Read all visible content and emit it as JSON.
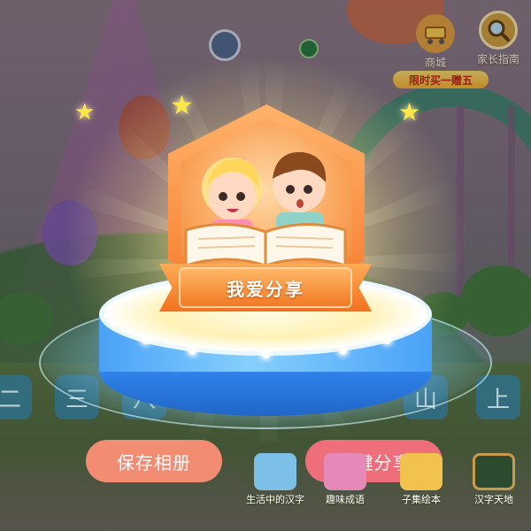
{
  "badge": {
    "title": "我爱分享",
    "artwork": "children-reading-book-illustration"
  },
  "actions": {
    "save_label": "保存相册",
    "share_label": "一键分享"
  },
  "top_bar": {
    "mall_label": "商城",
    "promo_label": "限时买一赠五",
    "parent_guide_label": "家长指南"
  },
  "char_tiles": [
    "二",
    "三",
    "八",
    "",
    "",
    "",
    "山",
    "上"
  ],
  "bottom_nav": [
    {
      "label": "生活中的汉字",
      "icon": "kids-reading-icon"
    },
    {
      "label": "趣味成语",
      "icon": "idiom-icon"
    },
    {
      "label": "子集绘本",
      "icon": "picture-book-icon"
    },
    {
      "label": "汉字天地",
      "icon": "chalkboard-icon"
    }
  ],
  "colors": {
    "save_button": "#f28d74",
    "share_button": "#ef6e7c",
    "badge_orange": "#f6792a",
    "pedestal_blue": "#2e7fe6"
  }
}
